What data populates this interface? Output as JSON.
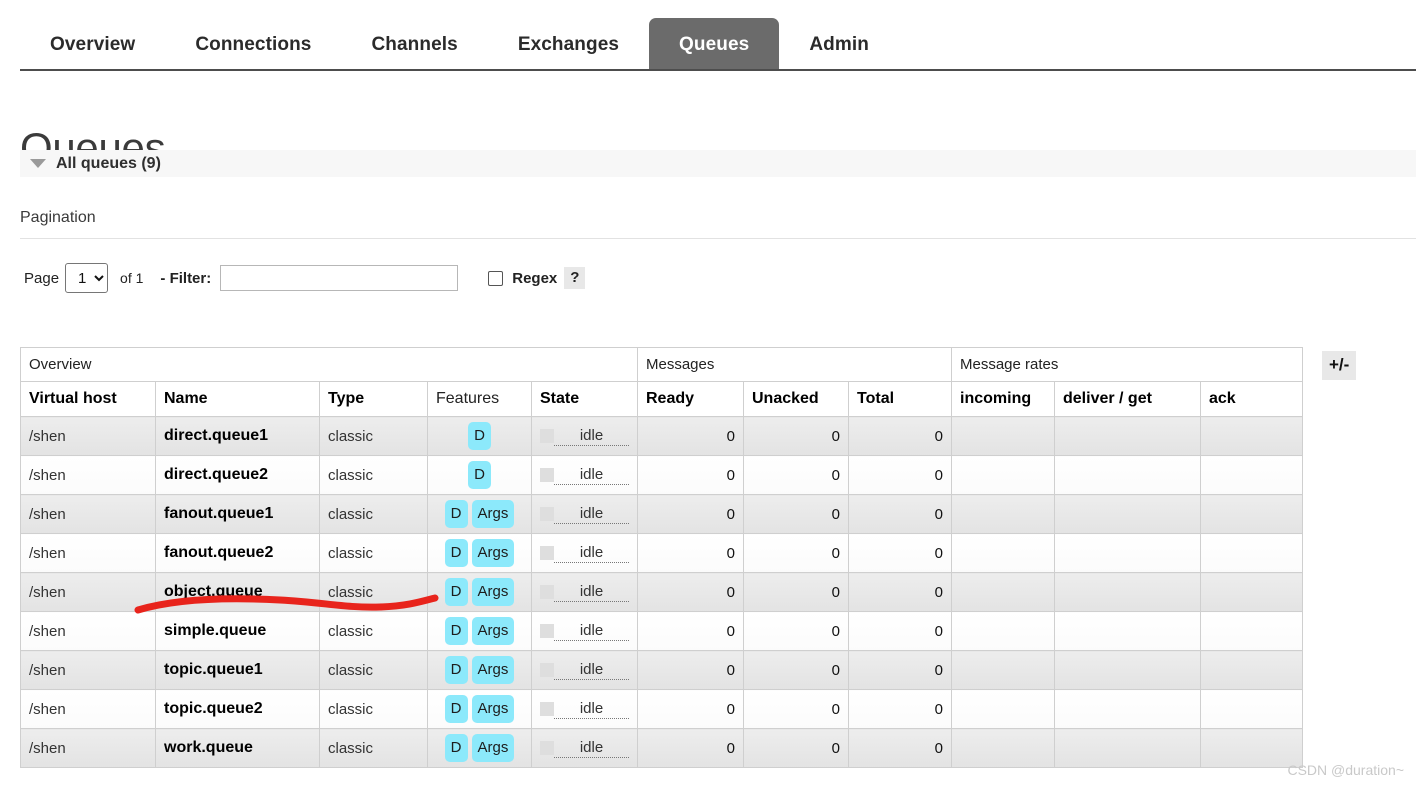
{
  "nav": {
    "tabs": [
      {
        "label": "Overview",
        "active": false
      },
      {
        "label": "Connections",
        "active": false
      },
      {
        "label": "Channels",
        "active": false
      },
      {
        "label": "Exchanges",
        "active": false
      },
      {
        "label": "Queues",
        "active": true
      },
      {
        "label": "Admin",
        "active": false
      }
    ]
  },
  "page": {
    "title": "Queues",
    "section_label": "All queues (9)",
    "pagination_heading": "Pagination"
  },
  "pagination": {
    "page_word": "Page",
    "page_value": "1",
    "page_options": [
      "1"
    ],
    "of_text": "of 1",
    "filter_label": "- Filter:",
    "filter_value": "",
    "filter_placeholder": "",
    "regex_label": "Regex",
    "regex_checked": false,
    "help_label": "?"
  },
  "table": {
    "group_headers": [
      {
        "label": "Overview",
        "span": 5
      },
      {
        "label": "Messages",
        "span": 3
      },
      {
        "label": "Message rates",
        "span": 3
      }
    ],
    "columns": [
      {
        "label": "Virtual host",
        "bold": true
      },
      {
        "label": "Name",
        "bold": true
      },
      {
        "label": "Type",
        "bold": true
      },
      {
        "label": "Features",
        "bold": false
      },
      {
        "label": "State",
        "bold": true
      },
      {
        "label": "Ready",
        "bold": true
      },
      {
        "label": "Unacked",
        "bold": true
      },
      {
        "label": "Total",
        "bold": true
      },
      {
        "label": "incoming",
        "bold": true
      },
      {
        "label": "deliver / get",
        "bold": true
      },
      {
        "label": "ack",
        "bold": true
      }
    ],
    "toggle_columns_label": "+/-",
    "rows": [
      {
        "vhost": "/shen",
        "name": "direct.queue1",
        "type": "classic",
        "features": [
          "D"
        ],
        "state": "idle",
        "ready": "0",
        "unacked": "0",
        "total": "0",
        "incoming": "",
        "deliver_get": "",
        "ack": ""
      },
      {
        "vhost": "/shen",
        "name": "direct.queue2",
        "type": "classic",
        "features": [
          "D"
        ],
        "state": "idle",
        "ready": "0",
        "unacked": "0",
        "total": "0",
        "incoming": "",
        "deliver_get": "",
        "ack": ""
      },
      {
        "vhost": "/shen",
        "name": "fanout.queue1",
        "type": "classic",
        "features": [
          "D",
          "Args"
        ],
        "state": "idle",
        "ready": "0",
        "unacked": "0",
        "total": "0",
        "incoming": "",
        "deliver_get": "",
        "ack": ""
      },
      {
        "vhost": "/shen",
        "name": "fanout.queue2",
        "type": "classic",
        "features": [
          "D",
          "Args"
        ],
        "state": "idle",
        "ready": "0",
        "unacked": "0",
        "total": "0",
        "incoming": "",
        "deliver_get": "",
        "ack": ""
      },
      {
        "vhost": "/shen",
        "name": "object.queue",
        "type": "classic",
        "features": [
          "D",
          "Args"
        ],
        "state": "idle",
        "ready": "0",
        "unacked": "0",
        "total": "0",
        "incoming": "",
        "deliver_get": "",
        "ack": ""
      },
      {
        "vhost": "/shen",
        "name": "simple.queue",
        "type": "classic",
        "features": [
          "D",
          "Args"
        ],
        "state": "idle",
        "ready": "0",
        "unacked": "0",
        "total": "0",
        "incoming": "",
        "deliver_get": "",
        "ack": ""
      },
      {
        "vhost": "/shen",
        "name": "topic.queue1",
        "type": "classic",
        "features": [
          "D",
          "Args"
        ],
        "state": "idle",
        "ready": "0",
        "unacked": "0",
        "total": "0",
        "incoming": "",
        "deliver_get": "",
        "ack": ""
      },
      {
        "vhost": "/shen",
        "name": "topic.queue2",
        "type": "classic",
        "features": [
          "D",
          "Args"
        ],
        "state": "idle",
        "ready": "0",
        "unacked": "0",
        "total": "0",
        "incoming": "",
        "deliver_get": "",
        "ack": ""
      },
      {
        "vhost": "/shen",
        "name": "work.queue",
        "type": "classic",
        "features": [
          "D",
          "Args"
        ],
        "state": "idle",
        "ready": "0",
        "unacked": "0",
        "total": "0",
        "incoming": "",
        "deliver_get": "",
        "ack": ""
      }
    ]
  },
  "annotation": {
    "color": "#e8241c",
    "target_row": "object.queue"
  },
  "watermark": {
    "text": "CSDN @duration~"
  },
  "colors": {
    "active_tab_bg": "#6b6b6b",
    "badge_bg": "#8ce9fb",
    "row_stripe": "#e8e8e8",
    "annotation_red": "#e8241c"
  }
}
